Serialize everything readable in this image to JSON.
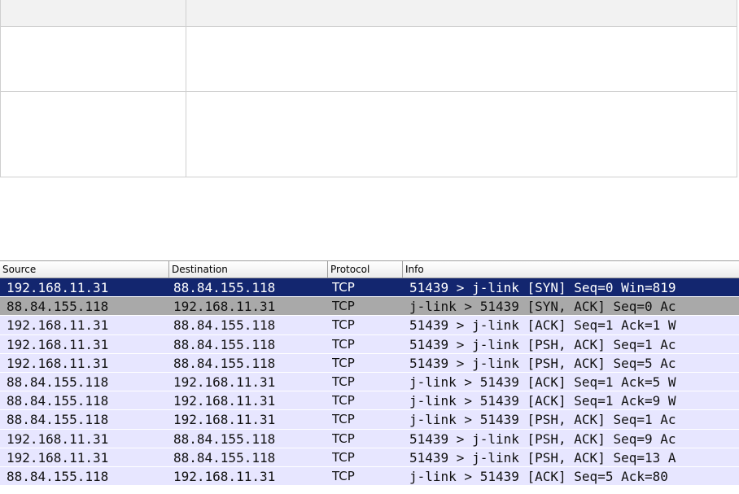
{
  "packet_list": {
    "columns": [
      "Source",
      "Destination",
      "Protocol",
      "Info"
    ],
    "rows": [
      {
        "source": "192.168.11.31",
        "destination": "88.84.155.118",
        "protocol": "TCP",
        "info": "51439 > j-link [SYN] Seq=0 Win=819",
        "state": "selected"
      },
      {
        "source": "88.84.155.118",
        "destination": "192.168.11.31",
        "protocol": "TCP",
        "info": "j-link > 51439 [SYN, ACK] Seq=0 Ac",
        "state": "marked"
      },
      {
        "source": "192.168.11.31",
        "destination": "88.84.155.118",
        "protocol": "TCP",
        "info": "51439 > j-link [ACK] Seq=1 Ack=1 W",
        "state": "normal"
      },
      {
        "source": "192.168.11.31",
        "destination": "88.84.155.118",
        "protocol": "TCP",
        "info": "51439 > j-link [PSH, ACK] Seq=1 Ac",
        "state": "normal"
      },
      {
        "source": "192.168.11.31",
        "destination": "88.84.155.118",
        "protocol": "TCP",
        "info": "51439 > j-link [PSH, ACK] Seq=5 Ac",
        "state": "normal"
      },
      {
        "source": "88.84.155.118",
        "destination": "192.168.11.31",
        "protocol": "TCP",
        "info": "j-link > 51439 [ACK] Seq=1 Ack=5 W",
        "state": "normal"
      },
      {
        "source": "88.84.155.118",
        "destination": "192.168.11.31",
        "protocol": "TCP",
        "info": "j-link > 51439 [ACK] Seq=1 Ack=9 W",
        "state": "normal"
      },
      {
        "source": "88.84.155.118",
        "destination": "192.168.11.31",
        "protocol": "TCP",
        "info": "j-link > 51439 [PSH, ACK] Seq=1 Ac",
        "state": "normal"
      },
      {
        "source": "192.168.11.31",
        "destination": "88.84.155.118",
        "protocol": "TCP",
        "info": "51439 > j-link [PSH, ACK] Seq=9 Ac",
        "state": "normal"
      },
      {
        "source": "192.168.11.31",
        "destination": "88.84.155.118",
        "protocol": "TCP",
        "info": "51439 > j-link [PSH, ACK] Seq=13 A",
        "state": "normal"
      },
      {
        "source": "88.84.155.118",
        "destination": "192.168.11.31",
        "protocol": "TCP",
        "info": "j-link > 51439 [ACK] Seq=5 Ack=80",
        "state": "normal"
      }
    ]
  },
  "colors": {
    "selected_bg": "#13266f",
    "selected_fg": "#ffffff",
    "marked_bg": "#a9a9a9",
    "tcp_row_bg": "#e7e6ff"
  }
}
